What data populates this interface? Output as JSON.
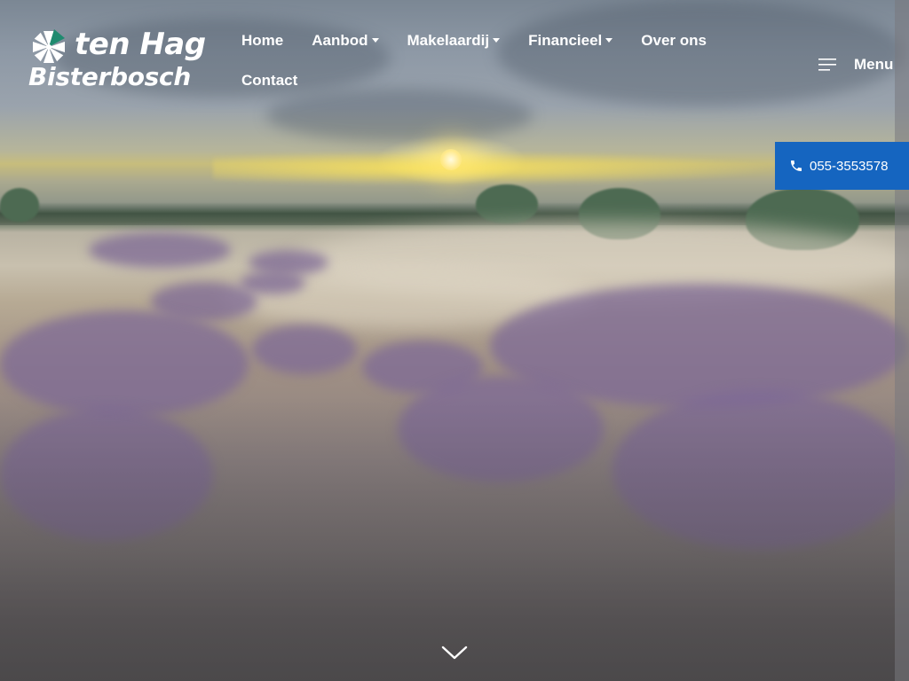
{
  "brand": {
    "name_line1": "ten Hag",
    "name_line2": "Bisterbosch"
  },
  "nav": {
    "items": [
      {
        "label": "Home",
        "has_dropdown": false
      },
      {
        "label": "Aanbod",
        "has_dropdown": true
      },
      {
        "label": "Makelaardij",
        "has_dropdown": true
      },
      {
        "label": "Financieel",
        "has_dropdown": true
      },
      {
        "label": "Over ons",
        "has_dropdown": false
      },
      {
        "label": "Contact",
        "has_dropdown": false
      }
    ]
  },
  "menu": {
    "label": "Menu",
    "icon": "hamburger-menu-icon"
  },
  "phone": {
    "label": "055-3553578",
    "icon": "phone-icon"
  },
  "hero": {
    "scroll_icon": "chevron-down-icon"
  },
  "colors": {
    "phone_button_bg": "#1565c0",
    "logo_accent_green": "#1f8a6f",
    "text_white": "#ffffff"
  }
}
